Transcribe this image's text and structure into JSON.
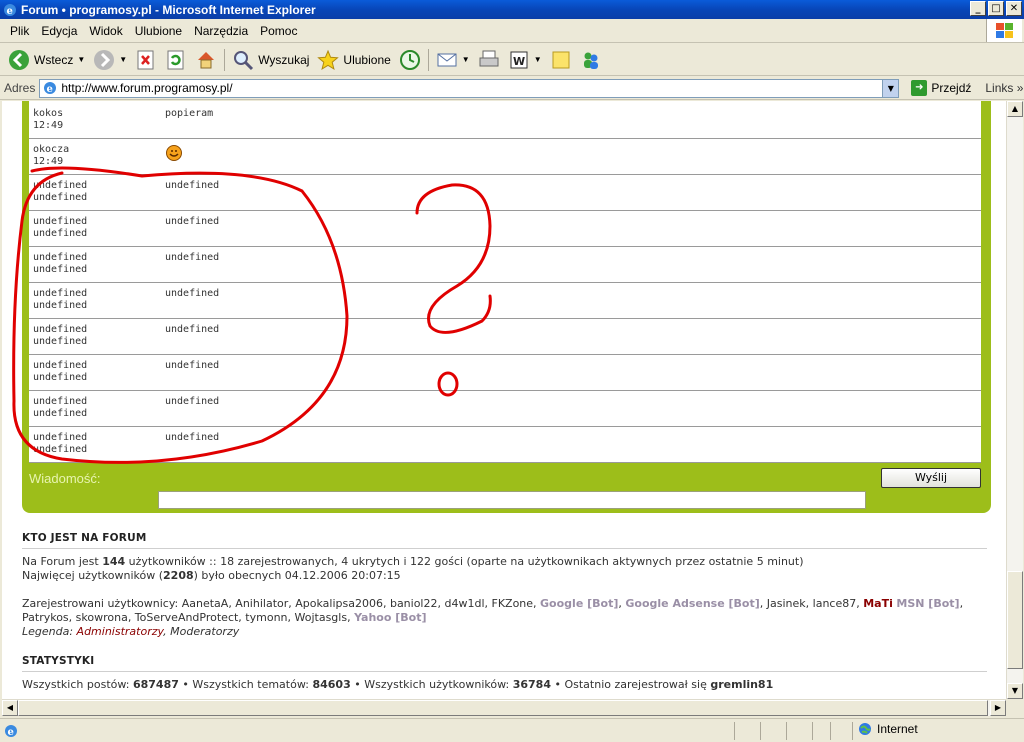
{
  "window": {
    "title": "Forum • programosy.pl - Microsoft Internet Explorer",
    "buttons": {
      "minimize": "_",
      "maximize": "□",
      "close": "✕"
    }
  },
  "menu": [
    "Plik",
    "Edycja",
    "Widok",
    "Ulubione",
    "Narzędzia",
    "Pomoc"
  ],
  "toolbar": {
    "back": "Wstecz",
    "search": "Wyszukaj",
    "favorites": "Ulubione"
  },
  "address": {
    "label": "Adres",
    "url": "http://www.forum.programosy.pl/",
    "go": "Przejdź",
    "links": "Links"
  },
  "chat": {
    "rows": [
      {
        "user": "kokos",
        "time": "12:49",
        "message": "popieram"
      },
      {
        "user": "okocza",
        "time": "12:49",
        "message": ""
      },
      {
        "user": "undefined",
        "time": "undefined",
        "message": "undefined"
      },
      {
        "user": "undefined",
        "time": "undefined",
        "message": "undefined"
      },
      {
        "user": "undefined",
        "time": "undefined",
        "message": "undefined"
      },
      {
        "user": "undefined",
        "time": "undefined",
        "message": "undefined"
      },
      {
        "user": "undefined",
        "time": "undefined",
        "message": "undefined"
      },
      {
        "user": "undefined",
        "time": "undefined",
        "message": "undefined"
      },
      {
        "user": "undefined",
        "time": "undefined",
        "message": "undefined"
      },
      {
        "user": "undefined",
        "time": "undefined",
        "message": "undefined"
      }
    ],
    "message_label": "Wiadomość:",
    "send": "Wyślij"
  },
  "who": {
    "heading": "KTO JEST NA FORUM",
    "line1_a": "Na Forum jest ",
    "line1_count": "144",
    "line1_b": " użytkowników :: 18 zarejestrowanych, 4 ukrytych i 122 gości (oparte na użytkownikach aktywnych przez ostatnie 5 minut)",
    "line2_a": "Najwięcej użytkowników (",
    "line2_count": "2208",
    "line2_b": ") było obecnych 04.12.2006 20:07:15",
    "registered_label": "Zarejestrowani użytkownicy: ",
    "users_1": "AanetaA, Anihilator, Apokalipsa2006, baniol22, d4w1dl, FKZone, ",
    "bot_google": "Google [Bot]",
    "sep": ", ",
    "bot_adsense": "Google Adsense [Bot]",
    "users_2": ", Jasinek, lance87, ",
    "admin_user": "MaTi",
    "bot_msn": "MSN [Bot]",
    "users_3": ", Patrykos, skowrona, ToServeAndProtect, tymonn, Wojtasgls, ",
    "bot_yahoo": "Yahoo [Bot]",
    "legend_label": "Legenda: ",
    "legend_admin": "Administratorzy",
    "legend_mod": "Moderatorzy"
  },
  "stats": {
    "heading": "STATYSTYKI",
    "posts_label": "Wszystkich postów: ",
    "posts": "687487",
    "topics_label": " • Wszystkich tematów: ",
    "topics": "84603",
    "users_label": " • Wszystkich użytkowników: ",
    "users": "36784",
    "last_label": " • Ostatnio zarejestrował się ",
    "last_user": "gremlin81"
  },
  "statusbar": {
    "zone": "Internet"
  },
  "colors": {
    "chat_green": "#9dbe1a",
    "annotation_red": "#e00000",
    "xp_blue": "#0a5bd9"
  }
}
